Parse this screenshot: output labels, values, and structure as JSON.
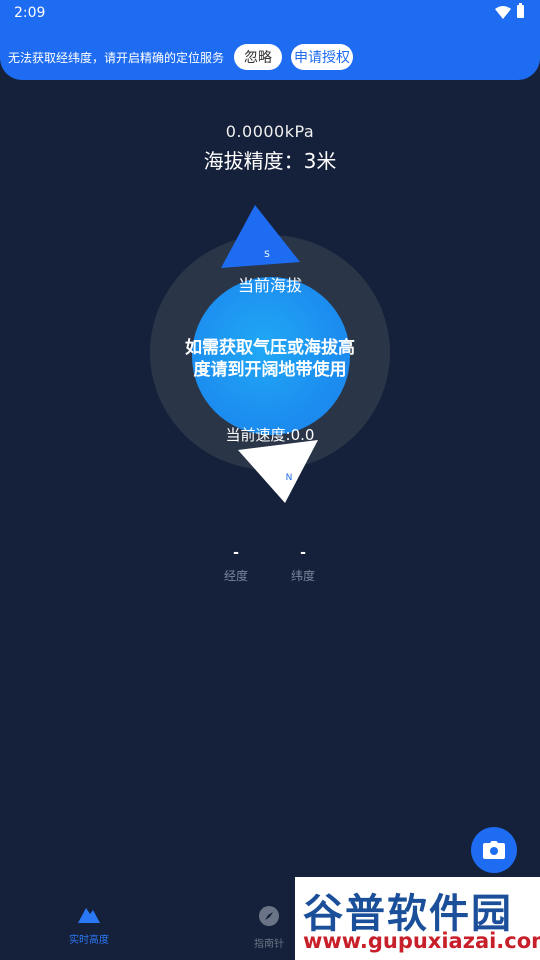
{
  "status": {
    "time": "2:09"
  },
  "banner": {
    "message": "无法获取经纬度，请开启精确的定位服务",
    "ignore_label": "忽略",
    "authorize_label": "申请授权"
  },
  "readings": {
    "pressure": "0.0000kPa",
    "accuracy": "海拔精度：3米"
  },
  "dial": {
    "altitude_label": "当前海拔",
    "message": "如需获取气压或海拔高度请到开阔地带使用",
    "speed_label": "当前速度:0.0",
    "top_marker": "S",
    "bottom_marker": "N"
  },
  "coords": {
    "longitude_value": "-",
    "longitude_label": "经度",
    "latitude_value": "-",
    "latitude_label": "纬度"
  },
  "nav": {
    "items": [
      {
        "label": "实时高度",
        "icon": "mountain-icon",
        "active": true
      },
      {
        "label": "指南针",
        "icon": "compass-icon",
        "active": false
      }
    ]
  },
  "watermark": {
    "title": "谷普软件园",
    "url": "www.gupuxiazai.com"
  },
  "colors": {
    "accent": "#1e6cf2",
    "background": "#15203a",
    "dial_ring": "#2a3548"
  }
}
